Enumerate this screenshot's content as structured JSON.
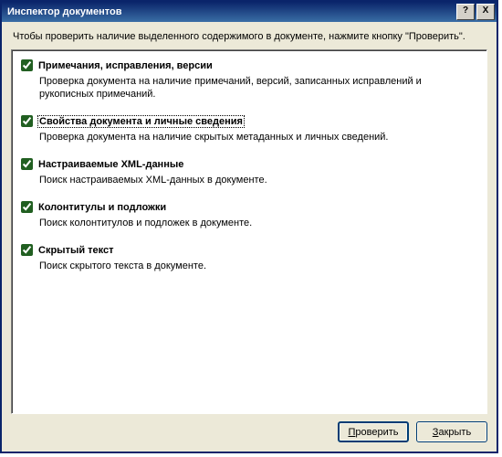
{
  "window": {
    "title": "Инспектор документов",
    "help_btn": "?",
    "close_btn": "X"
  },
  "instruction": "Чтобы проверить наличие выделенного содержимого в документе, нажмите кнопку \"Проверить\".",
  "items": [
    {
      "checked": true,
      "focused": false,
      "title": "Примечания, исправления, версии",
      "desc": "Проверка документа на наличие примечаний, версий, записанных исправлений и рукописных примечаний."
    },
    {
      "checked": true,
      "focused": true,
      "title": "Свойства документа и личные сведения",
      "desc": "Проверка документа на наличие скрытых метаданных и личных сведений."
    },
    {
      "checked": true,
      "focused": false,
      "title": "Настраиваемые XML-данные",
      "desc": "Поиск настраиваемых XML-данных в документе."
    },
    {
      "checked": true,
      "focused": false,
      "title": "Колонтитулы и подложки",
      "desc": "Поиск колонтитулов и подложек в документе."
    },
    {
      "checked": true,
      "focused": false,
      "title": "Скрытый текст",
      "desc": "Поиск скрытого текста в документе."
    }
  ],
  "buttons": {
    "inspect": {
      "text": "роверить",
      "mnemonic": "П"
    },
    "close": {
      "text": "акрыть",
      "mnemonic": "З"
    }
  }
}
